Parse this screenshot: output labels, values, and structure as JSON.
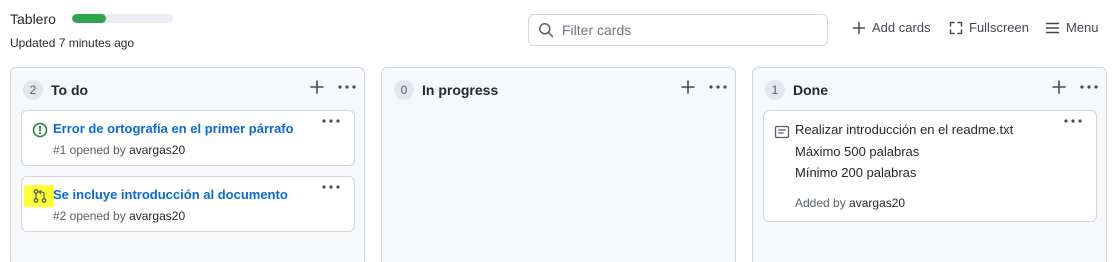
{
  "header": {
    "title": "Tablero",
    "progress_fraction": 0.34,
    "updated": "Updated 7 minutes ago",
    "filter_placeholder": "Filter cards",
    "add_cards": "Add cards",
    "fullscreen": "Fullscreen",
    "menu": "Menu"
  },
  "columns": [
    {
      "name": "To do",
      "count": "2",
      "cards": [
        {
          "icon": "issue-open-icon",
          "title": "Error de ortografía en el primer párrafo",
          "meta_prefix": "#1 opened by ",
          "author": "avargas20"
        },
        {
          "icon": "pull-request-icon",
          "title": "Se incluye introducción al documento",
          "meta_prefix": "#2 opened by ",
          "author": "avargas20"
        }
      ]
    },
    {
      "name": "In progress",
      "count": "0",
      "cards": []
    },
    {
      "name": "Done",
      "count": "1",
      "note": {
        "icon": "note-icon",
        "title": "Realizar introducción en el readme.txt",
        "lines": [
          "Máximo 500 palabras",
          "Mínimo 200 palabras"
        ],
        "meta_prefix": "Added by ",
        "author": "avargas20"
      }
    }
  ],
  "colors": {
    "progress": "#2da44e",
    "link": "#0969da",
    "issue_open": "#1a7f37",
    "highlight": "#ffff33"
  }
}
